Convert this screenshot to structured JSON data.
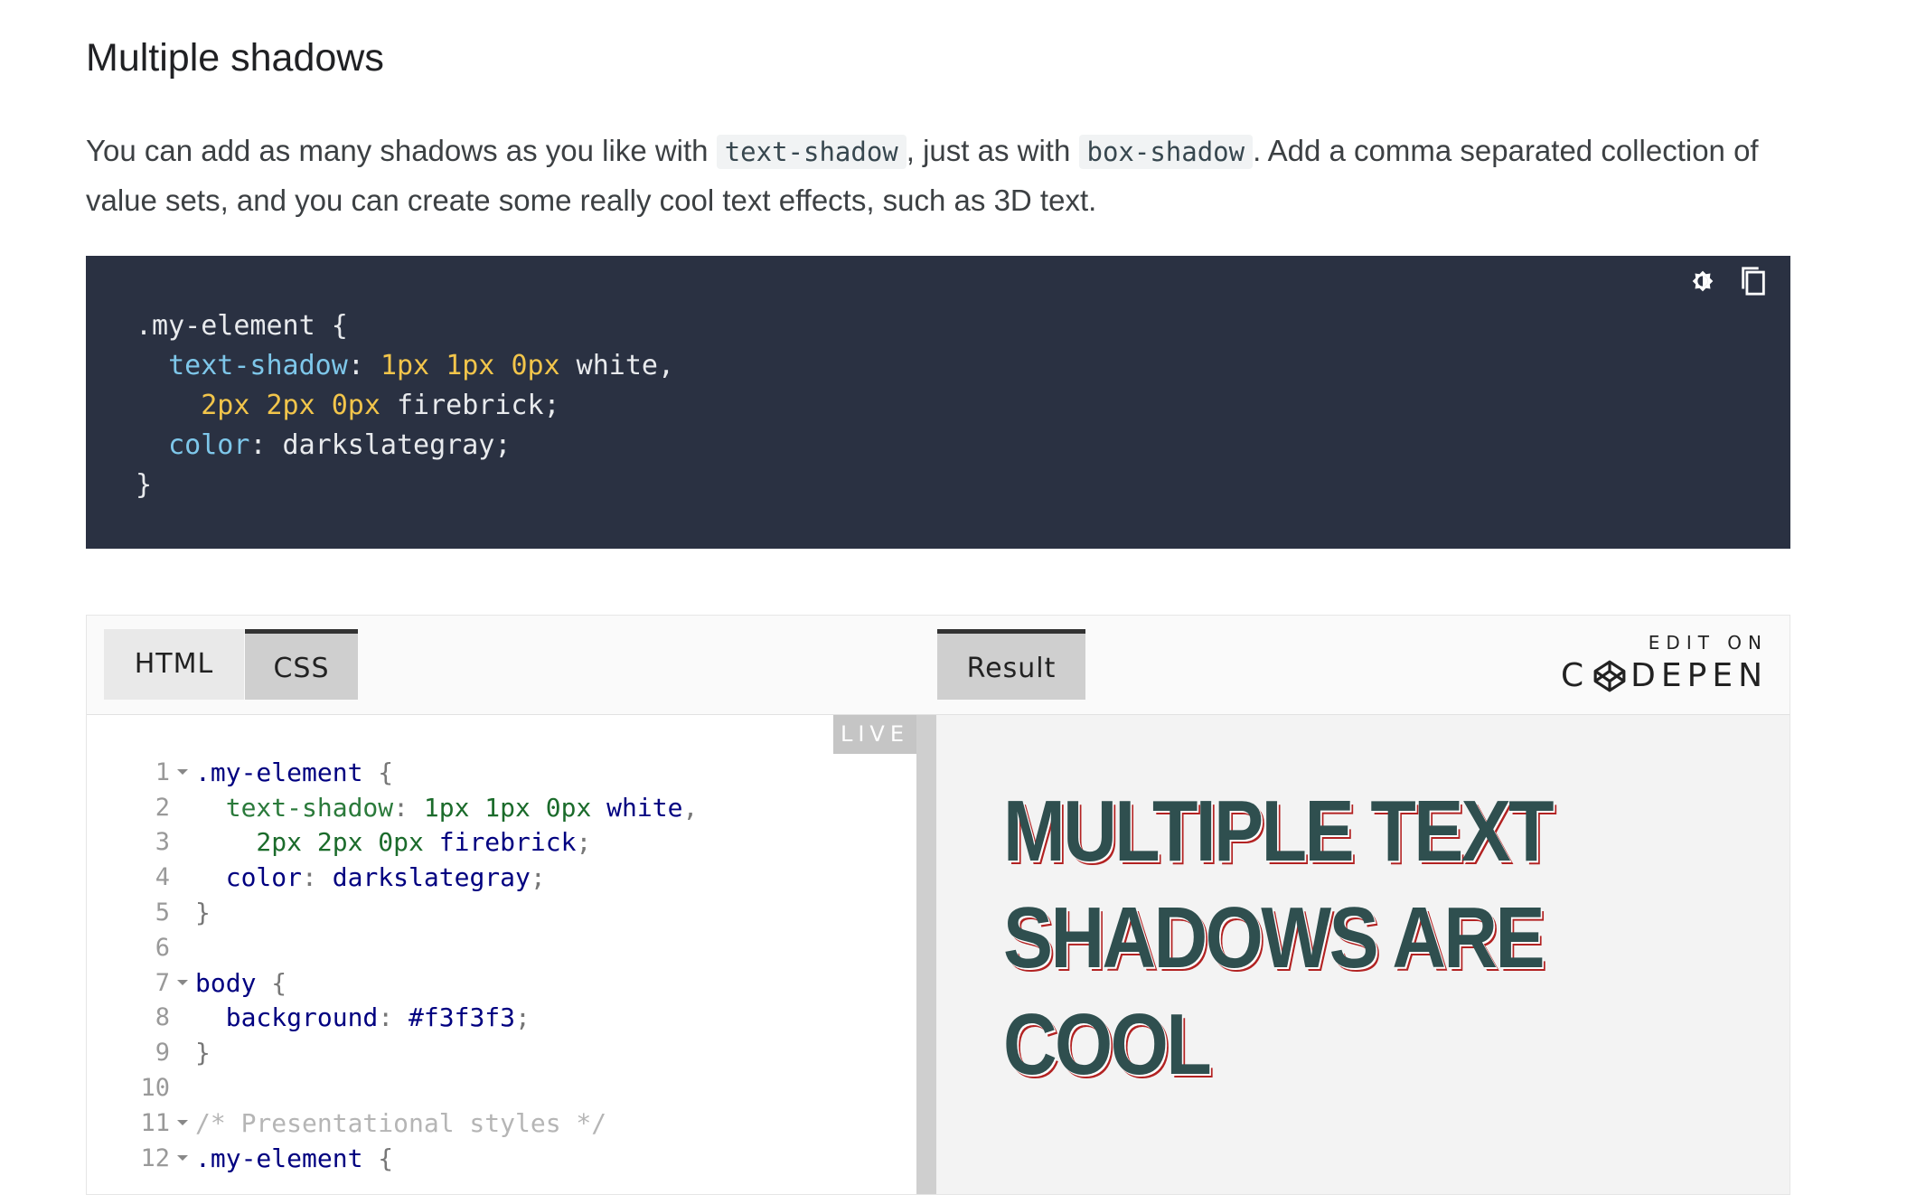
{
  "article": {
    "heading": "Multiple shadows",
    "para_part1": "You can add as many shadows as you like with ",
    "para_code1": "text-shadow",
    "para_part2": ", just as with ",
    "para_code2": "box-shadow",
    "para_part3": ". Add a comma separated collection of value sets, and you can create some really cool text effects, such as 3D text."
  },
  "codeblock": {
    "line1": ".my-element {",
    "l2_prop": "text-shadow",
    "l2_colon": ": ",
    "l2_n1": "1px",
    "l2_n2": "1px",
    "l2_n3": "0px",
    "l2_rest": " white,",
    "l3_n1": "2px",
    "l3_n2": "2px",
    "l3_n3": "0px",
    "l3_rest": " firebrick;",
    "l4_prop": "color",
    "l4_rest": ": darkslategray;",
    "line5": "}",
    "icons": [
      "theme-toggle-icon",
      "copy-icon"
    ]
  },
  "pen": {
    "tabs": {
      "html": "HTML",
      "css": "CSS",
      "result": "Result"
    },
    "edit_on": "EDIT ON",
    "brand_pre": "C",
    "brand_post": "DEPEN",
    "live": "LIVE",
    "editor_lines": [
      {
        "n": "1",
        "fold": true
      },
      {
        "n": "2",
        "fold": false
      },
      {
        "n": "3",
        "fold": false
      },
      {
        "n": "4",
        "fold": false
      },
      {
        "n": "5",
        "fold": false
      },
      {
        "n": "6",
        "fold": false
      },
      {
        "n": "7",
        "fold": true
      },
      {
        "n": "8",
        "fold": false
      },
      {
        "n": "9",
        "fold": false
      },
      {
        "n": "10",
        "fold": false
      },
      {
        "n": "11",
        "fold": true
      },
      {
        "n": "12",
        "fold": true
      }
    ],
    "code": {
      "l1_sel": ".my-element",
      "l1_brace": " {",
      "l2_prop": "  text-shadow",
      "l2_colon": ": ",
      "l2_val": "1px 1px 0px",
      "l2_kw": " white",
      "l2_end": ",",
      "l3_val": "    2px 2px 0px",
      "l3_kw": " firebrick",
      "l3_end": ";",
      "l4_prop": "  color",
      "l4_colon": ": ",
      "l4_kw": "darkslategray",
      "l4_end": ";",
      "l5": "}",
      "l7_sel": "body",
      "l7_brace": " {",
      "l8_prop": "  background",
      "l8_colon": ": ",
      "l8_val": "#f3f3f3",
      "l8_end": ";",
      "l9": "}",
      "l11_comment": "/* Presentational styles */",
      "l12_sel": ".my-element",
      "l12_brace": " {"
    },
    "result_text": "Multiple text shadows are cool"
  },
  "colors": {
    "code_bg": "#2a3142",
    "result_bg": "#f3f3f3",
    "text_color": "#2f4f4f",
    "shadow_color": "#b22222"
  }
}
